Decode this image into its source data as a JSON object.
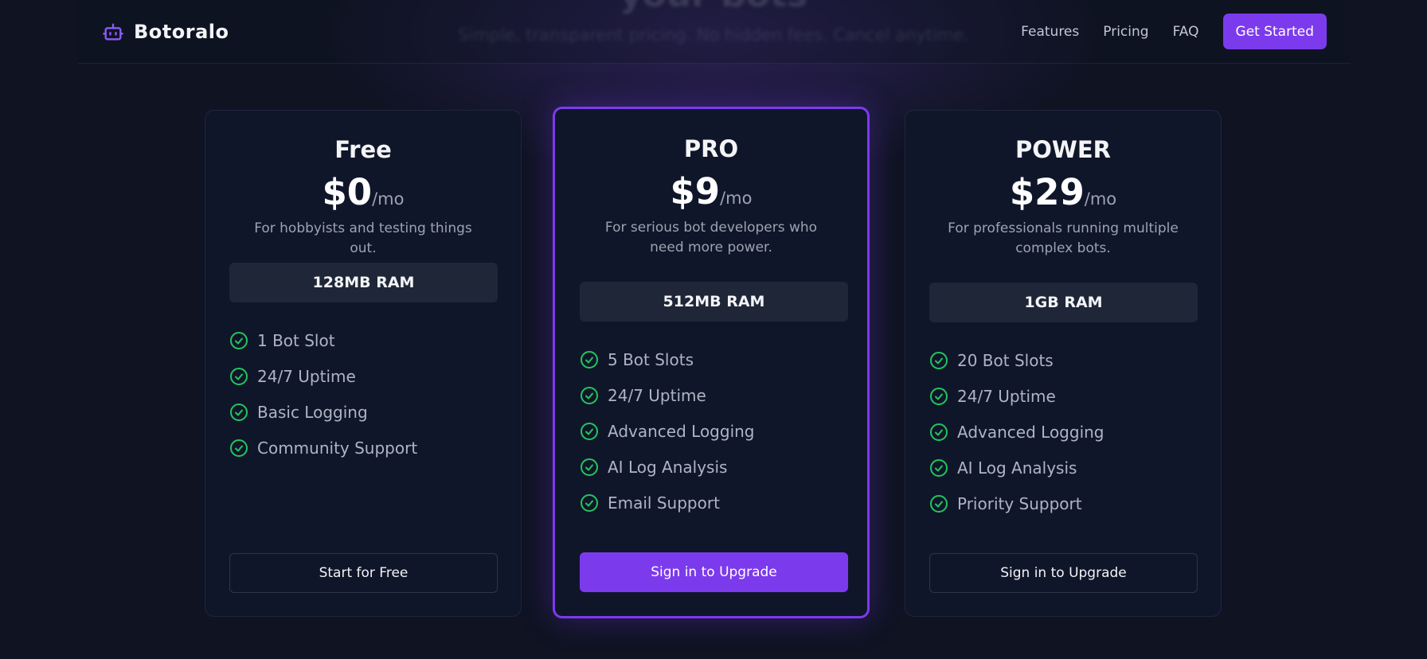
{
  "hero": {
    "title": "your bots",
    "subtitle": "Simple, transparent pricing. No hidden fees. Cancel anytime."
  },
  "header": {
    "brand": "Botoralo",
    "nav": [
      "Features",
      "Pricing",
      "FAQ"
    ],
    "cta": "Get Started"
  },
  "colors": {
    "accent": "#7c3aed",
    "check": "#22c55e",
    "background": "#0f1322"
  },
  "plans": [
    {
      "name": "Free",
      "price": "$0",
      "unit": "/mo",
      "description": "For hobbyists and testing things out.",
      "ram": "128MB RAM",
      "features": [
        "1 Bot Slot",
        "24/7 Uptime",
        "Basic Logging",
        "Community Support"
      ],
      "button": "Start for Free",
      "icon": "check-circle-icon"
    },
    {
      "name": "PRO",
      "price": "$9",
      "unit": "/mo",
      "description": "For serious bot developers who need more power.",
      "ram": "512MB RAM",
      "features": [
        "5 Bot Slots",
        "24/7 Uptime",
        "Advanced Logging",
        "AI Log Analysis",
        "Email Support"
      ],
      "button": "Sign in to Upgrade",
      "icon": "check-circle-icon"
    },
    {
      "name": "POWER",
      "price": "$29",
      "unit": "/mo",
      "description": "For professionals running multiple complex bots.",
      "ram": "1GB RAM",
      "features": [
        "20 Bot Slots",
        "24/7 Uptime",
        "Advanced Logging",
        "AI Log Analysis",
        "Priority Support"
      ],
      "button": "Sign in to Upgrade",
      "icon": "check-circle-icon"
    }
  ]
}
